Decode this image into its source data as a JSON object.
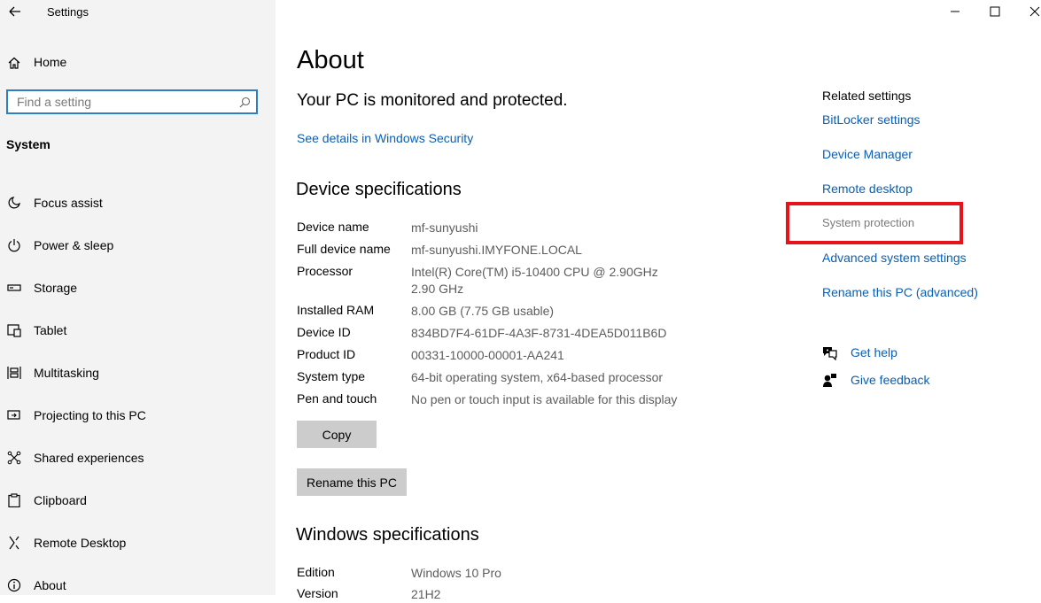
{
  "window": {
    "title": "Settings",
    "icons": {
      "back": "back-arrow-icon",
      "minimize": "minimize-icon",
      "maximize": "maximize-icon",
      "close": "close-icon"
    }
  },
  "sidebar": {
    "home_label": "Home",
    "search_placeholder": "Find a setting",
    "section": "System",
    "items": [
      {
        "label": "Focus assist",
        "icon": "moon-icon"
      },
      {
        "label": "Power & sleep",
        "icon": "power-icon"
      },
      {
        "label": "Storage",
        "icon": "storage-icon"
      },
      {
        "label": "Tablet",
        "icon": "tablet-icon"
      },
      {
        "label": "Multitasking",
        "icon": "multitasking-icon"
      },
      {
        "label": "Projecting to this PC",
        "icon": "projecting-icon"
      },
      {
        "label": "Shared experiences",
        "icon": "shared-icon"
      },
      {
        "label": "Clipboard",
        "icon": "clipboard-icon"
      },
      {
        "label": "Remote Desktop",
        "icon": "remote-desktop-icon"
      },
      {
        "label": "About",
        "icon": "info-icon"
      }
    ]
  },
  "main": {
    "title": "About",
    "protection_message": "Your PC is monitored and protected.",
    "security_link": "See details in Windows Security",
    "device_specs_title": "Device specifications",
    "device_specs": [
      {
        "key": "Device name",
        "value": "mf-sunyushi"
      },
      {
        "key": "Full device name",
        "value": "mf-sunyushi.IMYFONE.LOCAL"
      },
      {
        "key": "Processor",
        "value": "Intel(R) Core(TM) i5-10400 CPU @ 2.90GHz   2.90 GHz"
      },
      {
        "key": "Installed RAM",
        "value": "8.00 GB (7.75 GB usable)"
      },
      {
        "key": "Device ID",
        "value": "834BD7F4-61DF-4A3F-8731-4DEA5D011B6D"
      },
      {
        "key": "Product ID",
        "value": "00331-10000-00001-AA241"
      },
      {
        "key": "System type",
        "value": "64-bit operating system, x64-based processor"
      },
      {
        "key": "Pen and touch",
        "value": "No pen or touch input is available for this display"
      }
    ],
    "copy_button": "Copy",
    "rename_button": "Rename this PC",
    "windows_specs_title": "Windows specifications",
    "windows_specs": [
      {
        "key": "Edition",
        "value": "Windows 10 Pro"
      },
      {
        "key": "Version",
        "value": "21H2"
      }
    ]
  },
  "related": {
    "title": "Related settings",
    "links": [
      {
        "label": "BitLocker settings",
        "state": "link"
      },
      {
        "label": "Device Manager",
        "state": "link"
      },
      {
        "label": "Remote desktop",
        "state": "link"
      },
      {
        "label": "System protection",
        "state": "disabled"
      },
      {
        "label": "Advanced system settings",
        "state": "link"
      },
      {
        "label": "Rename this PC (advanced)",
        "state": "link"
      }
    ],
    "help": {
      "label": "Get help",
      "icon": "help-chat-icon"
    },
    "feedback": {
      "label": "Give feedback",
      "icon": "feedback-icon"
    }
  },
  "colors": {
    "link": "#0a5fb4",
    "disabled_text": "#7a7a7a",
    "highlight": "#e8131a",
    "sidebar_bg": "#f3f3f3",
    "search_border": "#2d7fc2",
    "button_bg": "#cccccc"
  }
}
